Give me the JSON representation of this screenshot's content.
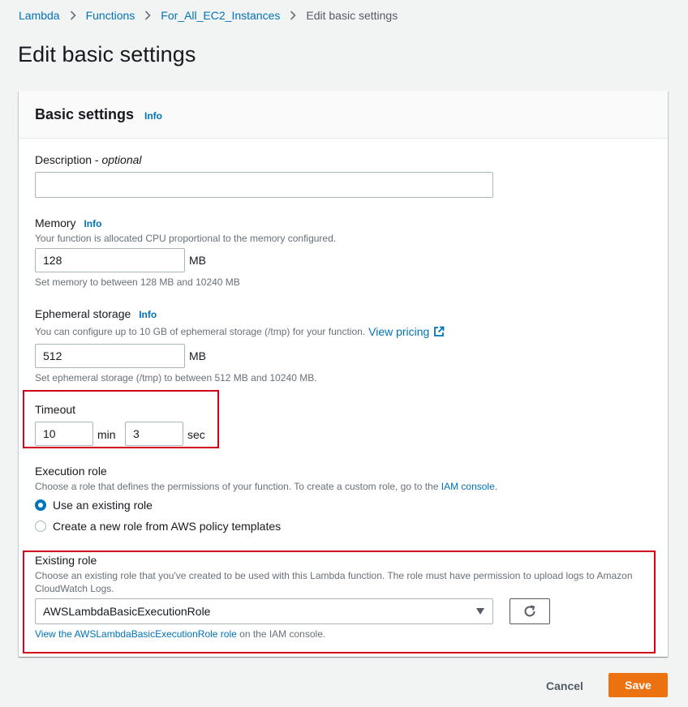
{
  "breadcrumb": {
    "items": [
      "Lambda",
      "Functions",
      "For_All_EC2_Instances"
    ],
    "current": "Edit basic settings"
  },
  "page_title": "Edit basic settings",
  "panel": {
    "title": "Basic settings",
    "info": "Info"
  },
  "description": {
    "label": "Description - ",
    "label_optional": "optional",
    "value": ""
  },
  "memory": {
    "label": "Memory",
    "info": "Info",
    "help": "Your function is allocated CPU proportional to the memory configured.",
    "value": "128",
    "unit": "MB",
    "constraint": "Set memory to between 128 MB and 10240 MB"
  },
  "ephemeral": {
    "label": "Ephemeral storage",
    "info": "Info",
    "help": "You can configure up to 10 GB of ephemeral storage (/tmp) for your function.",
    "pricing_link": "View pricing",
    "value": "512",
    "unit": "MB",
    "constraint": "Set ephemeral storage (/tmp) to between 512 MB and 10240 MB."
  },
  "timeout": {
    "label": "Timeout",
    "min_value": "10",
    "min_unit": "min",
    "sec_value": "3",
    "sec_unit": "sec"
  },
  "execution_role": {
    "label": "Execution role",
    "help_prefix": "Choose a role that defines the permissions of your function. To create a custom role, go to the ",
    "help_link": "IAM console",
    "help_suffix": ".",
    "options": [
      "Use an existing role",
      "Create a new role from AWS policy templates"
    ],
    "selected_index": 0
  },
  "existing_role": {
    "label": "Existing role",
    "help_line1": "Choose an existing role that you've created to be used with this Lambda function. The role must have permission to upload logs to Amazon",
    "help_line2": "CloudWatch Logs.",
    "selected": "AWSLambdaBasicExecutionRole",
    "view_link": "View the AWSLambdaBasicExecutionRole role",
    "view_suffix": " on the IAM console."
  },
  "footer": {
    "cancel": "Cancel",
    "save": "Save"
  },
  "colors": {
    "accent": "#0073bb",
    "primary_button": "#ec7211",
    "highlight_box": "#d0021b"
  },
  "icons": [
    "chevron-right-icon",
    "external-link-icon",
    "caret-down-icon",
    "refresh-icon"
  ]
}
